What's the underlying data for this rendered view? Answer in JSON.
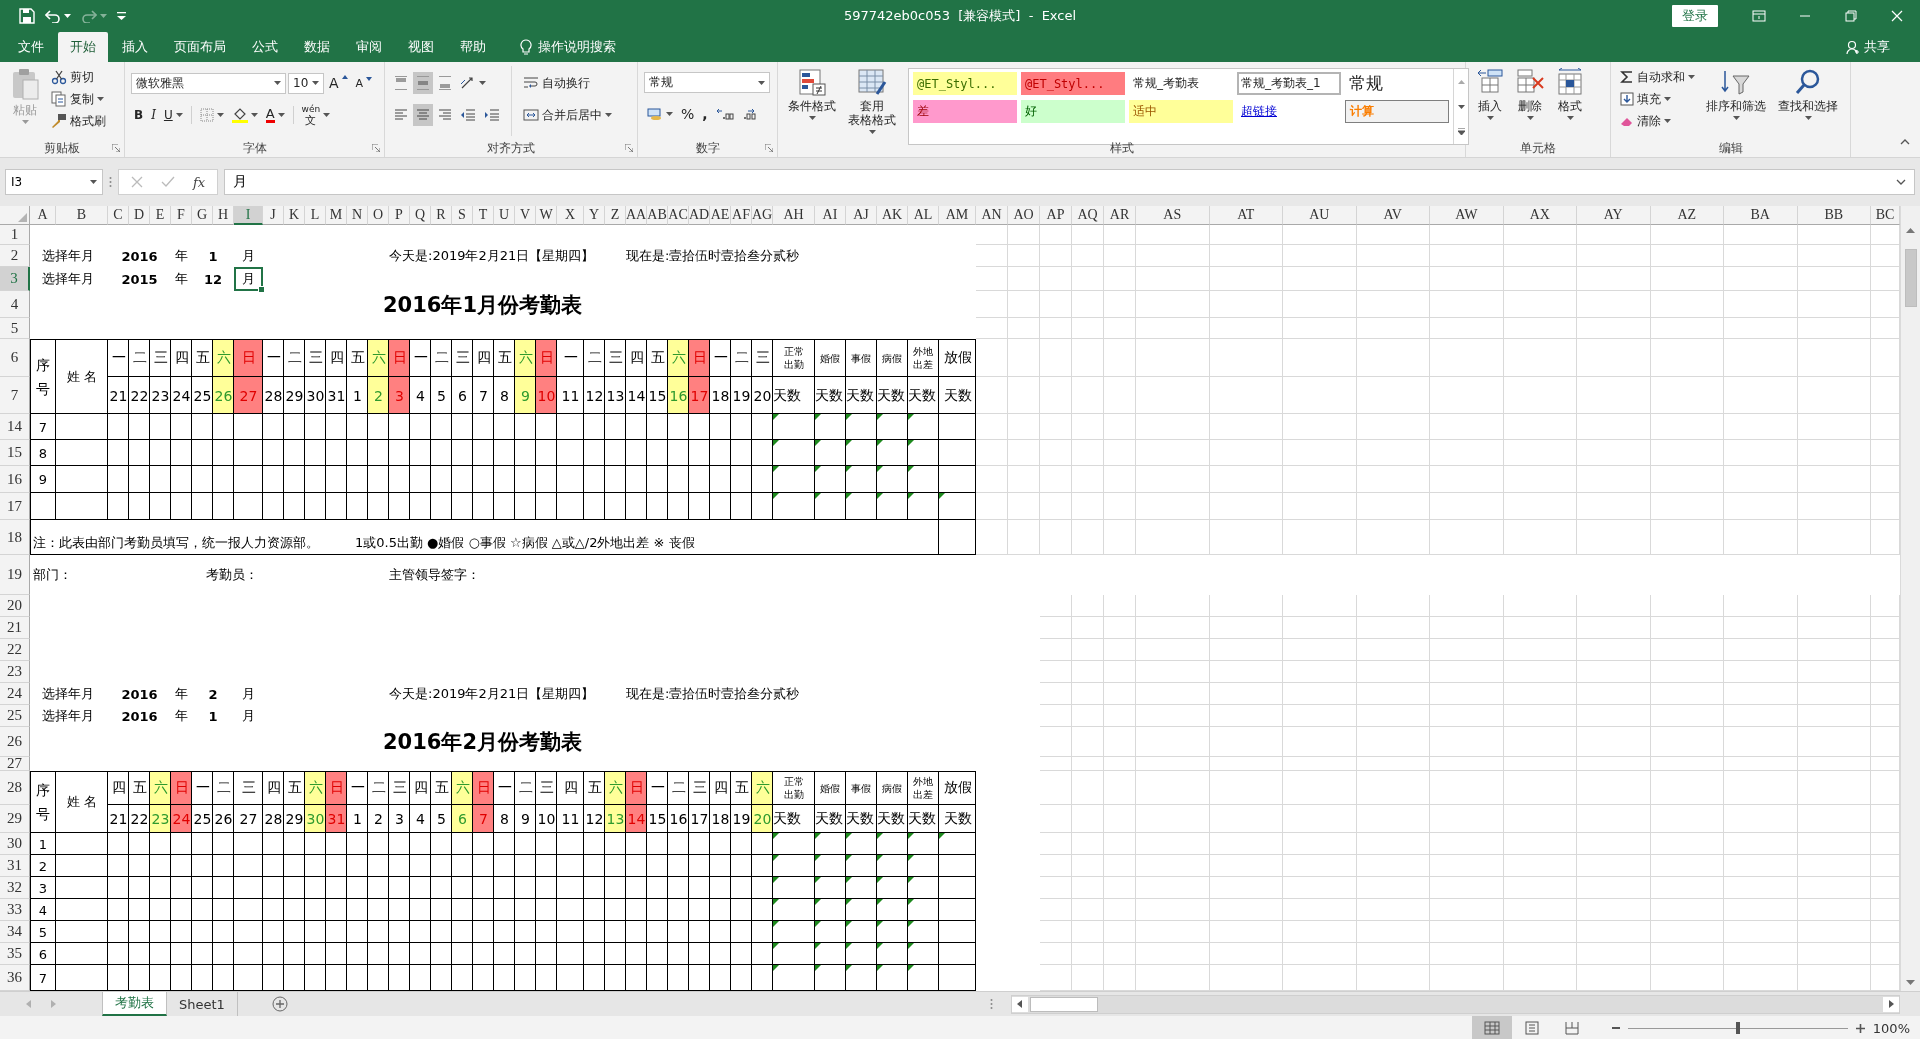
{
  "title_bar": {
    "quick_access": [
      {
        "kind": "save",
        "disabled": false
      },
      {
        "kind": "undo",
        "disabled": false
      },
      {
        "kind": "redo",
        "disabled": true
      },
      {
        "kind": "customize",
        "disabled": false
      }
    ],
    "title": "597742eb0c053  [兼容模式]  -  Excel",
    "login": "登录"
  },
  "menu_tabs": [
    {
      "label": "文件",
      "selected": false
    },
    {
      "label": "开始",
      "selected": true
    },
    {
      "label": "插入",
      "selected": false
    },
    {
      "label": "页面布局",
      "selected": false
    },
    {
      "label": "公式",
      "selected": false
    },
    {
      "label": "数据",
      "selected": false
    },
    {
      "label": "审阅",
      "selected": false
    },
    {
      "label": "视图",
      "selected": false
    },
    {
      "label": "帮助",
      "selected": false
    }
  ],
  "tell_me": "操作说明搜索",
  "share": "共享",
  "ribbon": {
    "clipboard": {
      "label": "剪贴板",
      "paste": "粘贴",
      "paste_disabled": true,
      "cut": "剪切",
      "copy": "复制",
      "format_painter": "格式刷"
    },
    "font": {
      "label": "字体",
      "font_name": "微软雅黑",
      "font_size": "10",
      "grow": "A",
      "shrink": "A",
      "bold": "B",
      "italic": "I",
      "underline": "U",
      "font_color": "A",
      "phonetic_top": "wén",
      "phonetic_bottom": "文"
    },
    "alignment": {
      "label": "对齐方式",
      "vertical": [
        {
          "selected": false
        },
        {
          "selected": true
        },
        {
          "selected": false
        }
      ],
      "horizontal": [
        {
          "selected": false
        },
        {
          "selected": true
        },
        {
          "selected": false
        }
      ],
      "wrap_text": "自动换行",
      "merge": "合并后居中"
    },
    "number": {
      "label": "数字",
      "format": "常规",
      "percent": "%",
      "comma": ","
    },
    "styles": {
      "label": "样式",
      "conditional": "条件格式",
      "table": [
        "套用",
        "表格格式"
      ],
      "gallery": [
        {
          "label": "@ET_Styl...",
          "kind": "note",
          "selected": false
        },
        {
          "label": "@ET_Styl...",
          "kind": "bad-custom",
          "selected": false
        },
        {
          "label": "常规_考勤表",
          "kind": "normal",
          "selected": false
        },
        {
          "label": "常规_考勤表_1",
          "kind": "normal",
          "selected": true
        },
        {
          "label": "常规",
          "kind": "heading",
          "selected": false
        },
        {
          "label": "差",
          "kind": "bad",
          "selected": false
        },
        {
          "label": "好",
          "kind": "good",
          "selected": false
        },
        {
          "label": "适中",
          "kind": "neutral",
          "selected": false
        },
        {
          "label": "超链接",
          "kind": "hyperlink",
          "selected": false
        },
        {
          "label": "计算",
          "kind": "calculation",
          "selected": false
        }
      ]
    },
    "cells": {
      "label": "单元格",
      "buttons": [
        {
          "kind": "insert",
          "label": "插入"
        },
        {
          "kind": "delete",
          "label": "删除"
        },
        {
          "kind": "format",
          "label": "格式"
        }
      ]
    },
    "editing": {
      "label": "编辑",
      "autosum": "自动求和",
      "fill": "填充",
      "clear": "清除",
      "sort": "排序和筛选",
      "find": "查找和选择"
    }
  },
  "formula_bar": {
    "name_box": "I3",
    "function_button": "fx",
    "formula": "月"
  },
  "sheet": {
    "columns": [
      {
        "label": "A",
        "selected": false
      },
      {
        "label": "B",
        "selected": false
      },
      {
        "label": "C",
        "selected": false
      },
      {
        "label": "D",
        "selected": false
      },
      {
        "label": "E",
        "selected": false
      },
      {
        "label": "F",
        "selected": false
      },
      {
        "label": "G",
        "selected": false
      },
      {
        "label": "H",
        "selected": false
      },
      {
        "label": "I",
        "selected": true
      },
      {
        "label": "J",
        "selected": false
      },
      {
        "label": "K",
        "selected": false
      },
      {
        "label": "L",
        "selected": false
      },
      {
        "label": "M",
        "selected": false
      },
      {
        "label": "N",
        "selected": false
      },
      {
        "label": "O",
        "selected": false
      },
      {
        "label": "P",
        "selected": false
      },
      {
        "label": "Q",
        "selected": false
      },
      {
        "label": "R",
        "selected": false
      },
      {
        "label": "S",
        "selected": false
      },
      {
        "label": "T",
        "selected": false
      },
      {
        "label": "U",
        "selected": false
      },
      {
        "label": "V",
        "selected": false
      },
      {
        "label": "W",
        "selected": false
      },
      {
        "label": "X",
        "selected": false
      },
      {
        "label": "Y",
        "selected": false
      },
      {
        "label": "Z",
        "selected": false
      },
      {
        "label": "AA",
        "selected": false
      },
      {
        "label": "AB",
        "selected": false
      },
      {
        "label": "AC",
        "selected": false
      },
      {
        "label": "AD",
        "selected": false
      },
      {
        "label": "AE",
        "selected": false
      },
      {
        "label": "AF",
        "selected": false
      },
      {
        "label": "AG",
        "selected": false
      },
      {
        "label": "AH",
        "selected": false
      },
      {
        "label": "AI",
        "selected": false
      },
      {
        "label": "AJ",
        "selected": false
      },
      {
        "label": "AK",
        "selected": false
      },
      {
        "label": "AL",
        "selected": false
      },
      {
        "label": "AM",
        "selected": false
      },
      {
        "label": "AN",
        "selected": false
      },
      {
        "label": "AO",
        "selected": false
      },
      {
        "label": "AP",
        "selected": false
      },
      {
        "label": "AQ",
        "selected": false
      },
      {
        "label": "AR",
        "selected": false
      },
      {
        "label": "AS",
        "selected": false
      },
      {
        "label": "AT",
        "selected": false
      },
      {
        "label": "AU",
        "selected": false
      },
      {
        "label": "AV",
        "selected": false
      },
      {
        "label": "AW",
        "selected": false
      },
      {
        "label": "AX",
        "selected": false
      },
      {
        "label": "AY",
        "selected": false
      },
      {
        "label": "AZ",
        "selected": false
      },
      {
        "label": "BA",
        "selected": false
      },
      {
        "label": "BB",
        "selected": false
      },
      {
        "label": "BC",
        "selected": false
      }
    ],
    "rows": [
      {
        "label": "1",
        "selected": false
      },
      {
        "label": "2",
        "selected": false
      },
      {
        "label": "3",
        "selected": true
      },
      {
        "label": "4",
        "selected": false
      },
      {
        "label": "5",
        "selected": false
      },
      {
        "label": "6",
        "selected": false
      },
      {
        "label": "7",
        "selected": false
      },
      {
        "label": "14",
        "selected": false
      },
      {
        "label": "15",
        "selected": false
      },
      {
        "label": "16",
        "selected": false
      },
      {
        "label": "17",
        "selected": false
      },
      {
        "label": "18",
        "selected": false
      },
      {
        "label": "19",
        "selected": false
      },
      {
        "label": "20",
        "selected": false
      },
      {
        "label": "21",
        "selected": false
      },
      {
        "label": "22",
        "selected": false
      },
      {
        "label": "23",
        "selected": false
      },
      {
        "label": "24",
        "selected": false
      },
      {
        "label": "25",
        "selected": false
      },
      {
        "label": "26",
        "selected": false
      },
      {
        "label": "27",
        "selected": false
      },
      {
        "label": "28",
        "selected": false
      },
      {
        "label": "29",
        "selected": false
      },
      {
        "label": "30",
        "selected": false
      },
      {
        "label": "31",
        "selected": false
      },
      {
        "label": "32",
        "selected": false
      },
      {
        "label": "33",
        "selected": false
      },
      {
        "label": "34",
        "selected": false
      },
      {
        "label": "35",
        "selected": false
      },
      {
        "label": "36",
        "selected": false
      }
    ],
    "blocks": [
      {
        "selectors": [
          {
            "label": "选择年月",
            "year": "2016",
            "year_unit": "年",
            "month": "1",
            "month_unit": "月",
            "selected": false
          },
          {
            "label": "选择年月",
            "year": "2015",
            "year_unit": "年",
            "month": "12",
            "month_unit": "月",
            "selected": true
          }
        ],
        "today": "今天是:2019年2月21日【星期四】",
        "now": "现在是:壹拾伍时壹拾叁分贰秒",
        "title": "2016年1月份考勤表",
        "table": {
          "no_header": "序号",
          "name_header": "姓 名",
          "days": [
            {
              "weekday": "一",
              "date": "21",
              "kind": "weekday"
            },
            {
              "weekday": "二",
              "date": "22",
              "kind": "weekday"
            },
            {
              "weekday": "三",
              "date": "23",
              "kind": "weekday"
            },
            {
              "weekday": "四",
              "date": "24",
              "kind": "weekday"
            },
            {
              "weekday": "五",
              "date": "25",
              "kind": "weekday"
            },
            {
              "weekday": "六",
              "date": "26",
              "kind": "saturday"
            },
            {
              "weekday": "日",
              "date": "27",
              "kind": "sunday"
            },
            {
              "weekday": "一",
              "date": "28",
              "kind": "weekday"
            },
            {
              "weekday": "二",
              "date": "29",
              "kind": "weekday"
            },
            {
              "weekday": "三",
              "date": "30",
              "kind": "weekday"
            },
            {
              "weekday": "四",
              "date": "31",
              "kind": "weekday"
            },
            {
              "weekday": "五",
              "date": "1",
              "kind": "weekday"
            },
            {
              "weekday": "六",
              "date": "2",
              "kind": "saturday"
            },
            {
              "weekday": "日",
              "date": "3",
              "kind": "sunday"
            },
            {
              "weekday": "一",
              "date": "4",
              "kind": "weekday"
            },
            {
              "weekday": "二",
              "date": "5",
              "kind": "weekday"
            },
            {
              "weekday": "三",
              "date": "6",
              "kind": "weekday"
            },
            {
              "weekday": "四",
              "date": "7",
              "kind": "weekday"
            },
            {
              "weekday": "五",
              "date": "8",
              "kind": "weekday"
            },
            {
              "weekday": "六",
              "date": "9",
              "kind": "saturday"
            },
            {
              "weekday": "日",
              "date": "10",
              "kind": "sunday"
            },
            {
              "weekday": "一",
              "date": "11",
              "kind": "weekday"
            },
            {
              "weekday": "二",
              "date": "12",
              "kind": "weekday"
            },
            {
              "weekday": "三",
              "date": "13",
              "kind": "weekday"
            },
            {
              "weekday": "四",
              "date": "14",
              "kind": "weekday"
            },
            {
              "weekday": "五",
              "date": "15",
              "kind": "weekday"
            },
            {
              "weekday": "六",
              "date": "16",
              "kind": "saturday"
            },
            {
              "weekday": "日",
              "date": "17",
              "kind": "sunday"
            },
            {
              "weekday": "一",
              "date": "18",
              "kind": "weekday"
            },
            {
              "weekday": "二",
              "date": "19",
              "kind": "weekday"
            },
            {
              "weekday": "三",
              "date": "20",
              "kind": "weekday"
            }
          ],
          "summary": [
            {
              "top": "正常出勤",
              "bottom": "天数"
            },
            {
              "top": "婚假",
              "bottom": "天数"
            },
            {
              "top": "事假",
              "bottom": "天数"
            },
            {
              "top": "病假",
              "bottom": "天数"
            },
            {
              "top": "外地出差",
              "bottom": "天数"
            },
            {
              "top": "放假",
              "bottom": "天数"
            }
          ],
          "rows": [
            {
              "no": "7",
              "warnings": [
                true,
                true,
                true,
                true,
                true,
                false
              ]
            },
            {
              "no": "8",
              "warnings": [
                true,
                true,
                true,
                true,
                true,
                false
              ]
            },
            {
              "no": "9",
              "warnings": [
                true,
                true,
                true,
                true,
                true,
                false
              ]
            },
            {
              "warnings": [
                true,
                true,
                true,
                true,
                true,
                true
              ]
            }
          ],
          "note": "注：此表由部门考勤员填写，统一报人力资源部。",
          "legend": "1或0.5出勤 ●婚假 ○事假 ☆病假 △或△/2外地出差 ※ 丧假"
        }
      },
      {
        "selectors": [
          {
            "label": "选择年月",
            "year": "2016",
            "year_unit": "年",
            "month": "2",
            "month_unit": "月",
            "selected": false
          },
          {
            "label": "选择年月",
            "year": "2016",
            "year_unit": "年",
            "month": "1",
            "month_unit": "月",
            "selected": false
          }
        ],
        "today": "今天是:2019年2月21日【星期四】",
        "now": "现在是:壹拾伍时壹拾叁分贰秒",
        "title": "2016年2月份考勤表",
        "table": {
          "no_header": "序号",
          "name_header": "姓 名",
          "days": [
            {
              "weekday": "四",
              "date": "21",
              "kind": "weekday"
            },
            {
              "weekday": "五",
              "date": "22",
              "kind": "weekday"
            },
            {
              "weekday": "六",
              "date": "23",
              "kind": "saturday"
            },
            {
              "weekday": "日",
              "date": "24",
              "kind": "sunday"
            },
            {
              "weekday": "一",
              "date": "25",
              "kind": "weekday"
            },
            {
              "weekday": "二",
              "date": "26",
              "kind": "weekday"
            },
            {
              "weekday": "三",
              "date": "27",
              "kind": "weekday"
            },
            {
              "weekday": "四",
              "date": "28",
              "kind": "weekday"
            },
            {
              "weekday": "五",
              "date": "29",
              "kind": "weekday"
            },
            {
              "weekday": "六",
              "date": "30",
              "kind": "saturday"
            },
            {
              "weekday": "日",
              "date": "31",
              "kind": "sunday"
            },
            {
              "weekday": "一",
              "date": "1",
              "kind": "weekday"
            },
            {
              "weekday": "二",
              "date": "2",
              "kind": "weekday"
            },
            {
              "weekday": "三",
              "date": "3",
              "kind": "weekday"
            },
            {
              "weekday": "四",
              "date": "4",
              "kind": "weekday"
            },
            {
              "weekday": "五",
              "date": "5",
              "kind": "weekday"
            },
            {
              "weekday": "六",
              "date": "6",
              "kind": "saturday"
            },
            {
              "weekday": "日",
              "date": "7",
              "kind": "sunday"
            },
            {
              "weekday": "一",
              "date": "8",
              "kind": "weekday"
            },
            {
              "weekday": "二",
              "date": "9",
              "kind": "weekday"
            },
            {
              "weekday": "三",
              "date": "10",
              "kind": "weekday"
            },
            {
              "weekday": "四",
              "date": "11",
              "kind": "weekday"
            },
            {
              "weekday": "五",
              "date": "12",
              "kind": "weekday"
            },
            {
              "weekday": "六",
              "date": "13",
              "kind": "saturday"
            },
            {
              "weekday": "日",
              "date": "14",
              "kind": "sunday"
            },
            {
              "weekday": "一",
              "date": "15",
              "kind": "weekday"
            },
            {
              "weekday": "二",
              "date": "16",
              "kind": "weekday"
            },
            {
              "weekday": "三",
              "date": "17",
              "kind": "weekday"
            },
            {
              "weekday": "四",
              "date": "18",
              "kind": "weekday"
            },
            {
              "weekday": "五",
              "date": "19",
              "kind": "weekday"
            },
            {
              "weekday": "六",
              "date": "20",
              "kind": "saturday"
            }
          ],
          "summary": [
            {
              "top": "正常出勤",
              "bottom": "天数"
            },
            {
              "top": "婚假",
              "bottom": "天数"
            },
            {
              "top": "事假",
              "bottom": "天数"
            },
            {
              "top": "病假",
              "bottom": "天数"
            },
            {
              "top": "外地出差",
              "bottom": "天数"
            },
            {
              "top": "放假",
              "bottom": "天数"
            }
          ],
          "rows": [
            {
              "no": "1",
              "warnings": [
                true,
                true,
                true,
                true,
                true,
                true
              ]
            },
            {
              "no": "2",
              "warnings": [
                true,
                true,
                true,
                true,
                true,
                false
              ]
            },
            {
              "no": "3",
              "warnings": [
                true,
                true,
                true,
                true,
                true,
                false
              ]
            },
            {
              "no": "4",
              "warnings": [
                true,
                true,
                true,
                true,
                true,
                false
              ]
            },
            {
              "no": "5",
              "warnings": [
                true,
                true,
                true,
                true,
                true,
                false
              ]
            },
            {
              "no": "6",
              "warnings": [
                true,
                true,
                true,
                true,
                true,
                false
              ]
            },
            {
              "no": "7",
              "warnings": [
                true,
                true,
                true,
                true,
                true,
                false
              ]
            }
          ]
        }
      }
    ],
    "signature": [
      "部门：",
      "考勤员：",
      "主管领导签字："
    ]
  },
  "sheet_tabs": [
    {
      "label": "考勤表",
      "selected": true
    },
    {
      "label": "Sheet1",
      "selected": false
    }
  ],
  "status_bar": {
    "views": [
      {
        "kind": "normal",
        "selected": true
      },
      {
        "kind": "page_layout",
        "selected": false
      },
      {
        "kind": "page_break",
        "selected": false
      }
    ],
    "zoom": {
      "level": 0.5,
      "label": "100%"
    }
  }
}
